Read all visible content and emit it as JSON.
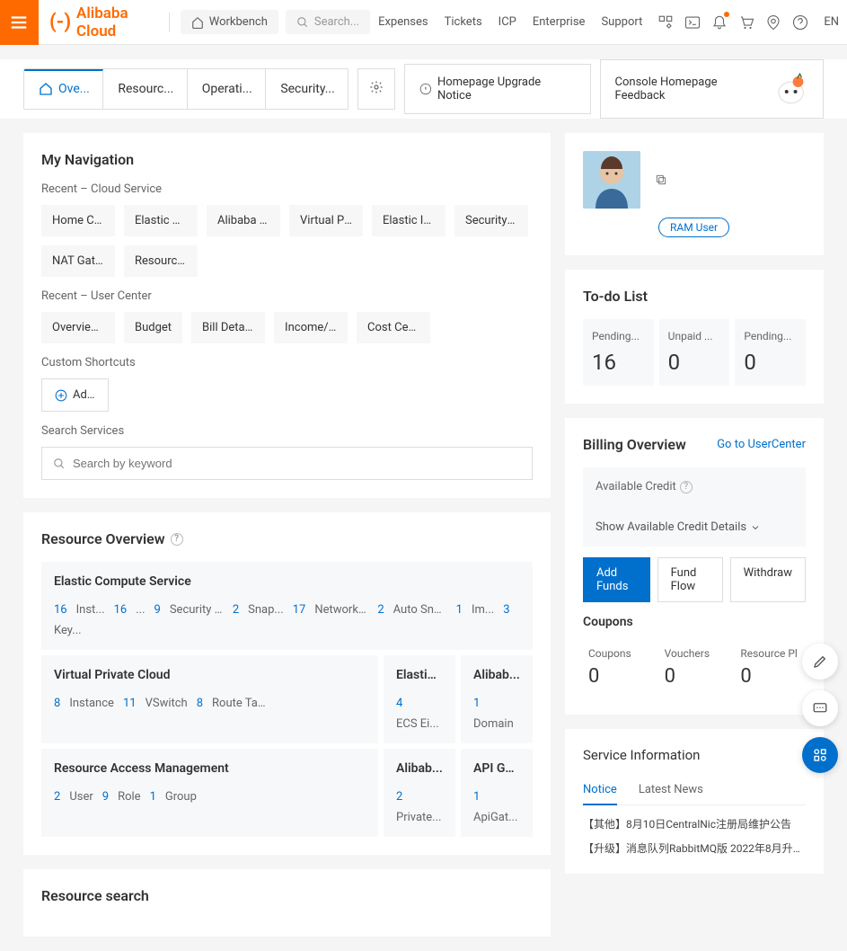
{
  "header": {
    "logo": "Alibaba Cloud",
    "workbench": "Workbench",
    "search_placeholder": "Search...",
    "links": [
      "Expenses",
      "Tickets",
      "ICP",
      "Enterprise",
      "Support"
    ],
    "lang": "EN"
  },
  "tabs": {
    "items": [
      "Ove...",
      "Resourc...",
      "Operati...",
      "Security..."
    ],
    "upgrade": "Homepage Upgrade Notice",
    "feedback": "Console Homepage Feedback"
  },
  "mynav": {
    "title": "My Navigation",
    "recent_service_label": "Recent – Cloud Service",
    "recent_services": [
      "Home Co...",
      "Elastic Co...",
      "Alibaba C...",
      "Virtual Pri...",
      "Elastic IP ...",
      "Security C...",
      "NAT Gate...",
      "Resource ..."
    ],
    "recent_user_label": "Recent – User Center",
    "recent_user": [
      "Overview ...",
      "Budget",
      "Bill Details",
      "Income/E...",
      "Cost Cent..."
    ],
    "custom_label": "Custom Shortcuts",
    "add": "Ad…",
    "search_label": "Search Services",
    "search_placeholder": "Search by keyword"
  },
  "res_overview": {
    "title": "Resource Overview",
    "ecs": {
      "name": "Elastic Compute Service",
      "items": [
        {
          "n": "16",
          "l": "Inst..."
        },
        {
          "n": "16",
          "l": "..."
        },
        {
          "n": "9",
          "l": "Security ..."
        },
        {
          "n": "2",
          "l": "Snap..."
        },
        {
          "n": "17",
          "l": "Network Int..."
        },
        {
          "n": "2",
          "l": "Auto Snapshot..."
        },
        {
          "n": "1",
          "l": "Im..."
        },
        {
          "n": "3",
          "l": "Key..."
        }
      ]
    },
    "vpc": {
      "name": "Virtual Private Cloud",
      "items": [
        {
          "n": "8",
          "l": "Instance"
        },
        {
          "n": "11",
          "l": "VSwitch"
        },
        {
          "n": "8",
          "l": "Route Table"
        }
      ]
    },
    "eip": {
      "name": "Elastic ...",
      "items": [
        {
          "n": "4",
          "l": "ECS Ei..."
        }
      ]
    },
    "dns": {
      "name": "Alibab...",
      "items": [
        {
          "n": "1",
          "l": "Domain"
        }
      ]
    },
    "ram": {
      "name": "Resource Access Management",
      "items": [
        {
          "n": "2",
          "l": "User"
        },
        {
          "n": "9",
          "l": "Role"
        },
        {
          "n": "1",
          "l": "Group"
        }
      ]
    },
    "acr": {
      "name": "Alibab...",
      "items": [
        {
          "n": "2",
          "l": "Private..."
        }
      ]
    },
    "apig": {
      "name": "API Ga...",
      "items": [
        {
          "n": "1",
          "l": "ApiGat..."
        }
      ]
    }
  },
  "res_search": {
    "title": "Resource search"
  },
  "user": {
    "badge": "RAM User"
  },
  "todo": {
    "title": "To-do List",
    "items": [
      {
        "label": "Pending...",
        "val": "16"
      },
      {
        "label": "Unpaid ...",
        "val": "0"
      },
      {
        "label": "Pending...",
        "val": "0"
      }
    ]
  },
  "billing": {
    "title": "Billing Overview",
    "link": "Go to UserCenter",
    "avail_label": "Available Credit",
    "detail": "Show Available Credit Details",
    "add_funds": "Add Funds",
    "fund_flow": "Fund Flow",
    "withdraw": "Withdraw",
    "coupons_title": "Coupons",
    "coupons": [
      {
        "label": "Coupons",
        "val": "0"
      },
      {
        "label": "Vouchers",
        "val": "0"
      },
      {
        "label": "Resource Pl",
        "val": "0"
      }
    ]
  },
  "svc": {
    "title": "Service Information",
    "tab_notice": "Notice",
    "tab_news": "Latest News",
    "notices": [
      "【其他】8月10日CentralNic注册局维护公告",
      "【升级】消息队列RabbitMQ版 2022年8月升级..."
    ]
  }
}
